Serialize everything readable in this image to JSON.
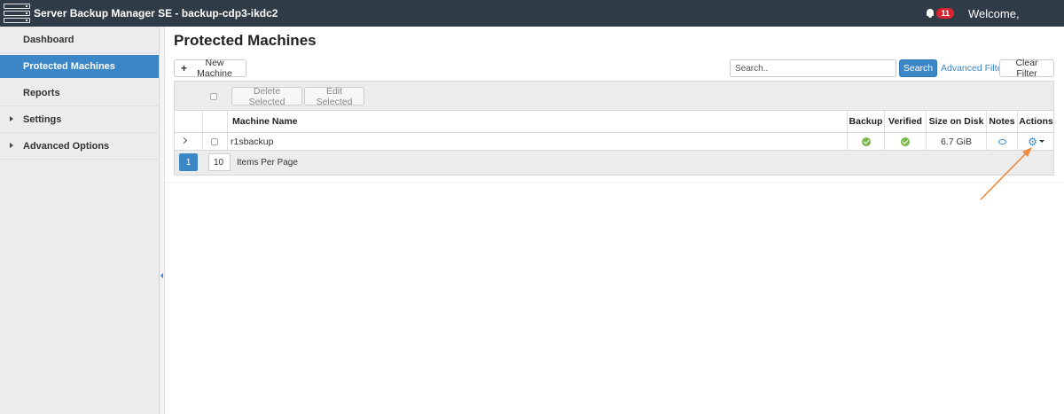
{
  "header": {
    "app_title": "Server Backup Manager SE - backup-cdp3-ikdc2",
    "notification_count": "11",
    "welcome": "Welcome,"
  },
  "sidebar": {
    "items": [
      {
        "label": "Dashboard"
      },
      {
        "label": "Protected Machines"
      },
      {
        "label": "Reports"
      },
      {
        "label": "Settings"
      },
      {
        "label": "Advanced Options"
      }
    ]
  },
  "main": {
    "title": "Protected Machines",
    "new_machine_label": "New Machine",
    "search_placeholder": "Search..",
    "search_button": "Search",
    "advanced_filter": "Advanced Filter",
    "clear_filter": "Clear Filter",
    "delete_selected": "Delete Selected",
    "edit_selected": "Edit Selected",
    "columns": [
      "Machine Name",
      "Backup",
      "Verified",
      "Size on Disk",
      "Notes",
      "Actions"
    ],
    "rows": [
      {
        "machine_name": "r1sbackup",
        "backup": "ok",
        "verified": "ok",
        "size_on_disk": "6.7 GiB",
        "notes": "comment-icon",
        "actions": "gear-icon"
      }
    ],
    "pagination": {
      "current_page": "1",
      "items_per_page": "10",
      "items_per_page_label": "Items Per Page"
    }
  },
  "colors": {
    "topbar": "#2f3b47",
    "accent": "#3b86c6",
    "success": "#7ab648",
    "badge": "#d9232f",
    "annotation_arrow": "#f08a3c"
  }
}
